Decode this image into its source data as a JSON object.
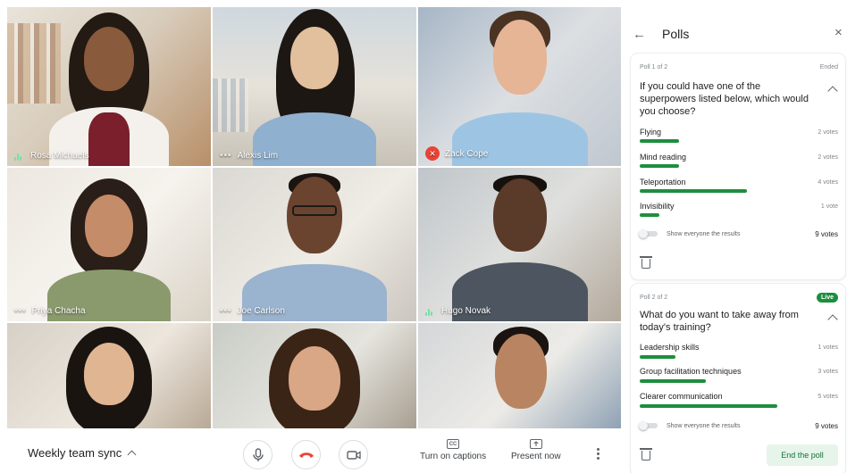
{
  "participants": [
    {
      "name": "Rosa Michaels",
      "status": "speaking"
    },
    {
      "name": "Alexis Lim",
      "status": "more"
    },
    {
      "name": "Zack Cope",
      "status": "muted"
    },
    {
      "name": "Priya Chacha",
      "status": "more"
    },
    {
      "name": "Joe Carlson",
      "status": "more"
    },
    {
      "name": "Hugo Novak",
      "status": "speaking"
    },
    {
      "name": "",
      "status": "none"
    },
    {
      "name": "",
      "status": "none"
    },
    {
      "name": "",
      "status": "none"
    }
  ],
  "bottom_bar": {
    "meeting_title": "Weekly team sync",
    "captions_label": "Turn on captions",
    "captions_icon_text": "CC",
    "present_label": "Present now"
  },
  "panel": {
    "title": "Polls",
    "back_icon": "←",
    "close_icon": "×",
    "polls": [
      {
        "number": "Poll 1 of 2",
        "status": "Ended",
        "question": "If you could have one of the superpowers listed below, which would you choose?",
        "options": [
          {
            "label": "Flying",
            "votes": "2 votes",
            "fraction": 0.22
          },
          {
            "label": "Mind reading",
            "votes": "2 votes",
            "fraction": 0.22
          },
          {
            "label": "Teleportation",
            "votes": "4 votes",
            "fraction": 0.6
          },
          {
            "label": "Invisibility",
            "votes": "1 vote",
            "fraction": 0.11
          }
        ],
        "toggle_label": "Show everyone the results",
        "total_votes": "9 votes"
      },
      {
        "number": "Poll 2 of 2",
        "status": "Live",
        "question": "What do you want to take away from today's training?",
        "options": [
          {
            "label": "Leadership skills",
            "votes": "1 votes",
            "fraction": 0.2
          },
          {
            "label": "Group facilitation techniques",
            "votes": "3 votes",
            "fraction": 0.37
          },
          {
            "label": "Clearer communication",
            "votes": "5 votes",
            "fraction": 0.77
          }
        ],
        "toggle_label": "Show everyone the results",
        "total_votes": "9 votes",
        "end_label": "End the poll"
      }
    ]
  },
  "colors": {
    "accent_green": "#1e8e3e",
    "hangup_red": "#ea4335",
    "end_button_bg": "#e6f4ea"
  }
}
